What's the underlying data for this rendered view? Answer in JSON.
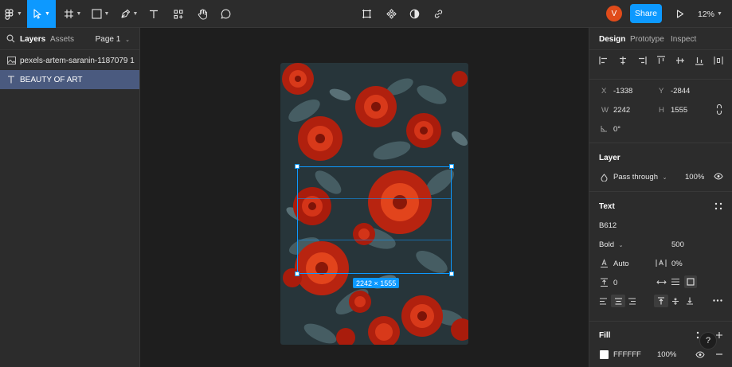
{
  "toolbar": {
    "tools": [
      "main-menu",
      "move",
      "frame",
      "shape",
      "pen",
      "text",
      "resources",
      "hand",
      "comment"
    ],
    "avatar_initial": "V",
    "share_label": "Share",
    "zoom_label": "12%"
  },
  "left_panel": {
    "tabs": [
      "Layers",
      "Assets"
    ],
    "page_label": "Page 1",
    "layers": [
      {
        "name": "pexels-artem-saranin-1187079 1",
        "icon": "image-icon"
      },
      {
        "name": "BEAUTY OF ART",
        "icon": "text-icon",
        "selected": true
      }
    ]
  },
  "canvas": {
    "dimension_label": "2242 × 1555"
  },
  "right_panel": {
    "tabs": [
      "Design",
      "Prototype",
      "Inspect"
    ],
    "position": {
      "x_label": "X",
      "x": "-1338",
      "y_label": "Y",
      "y": "-2844"
    },
    "size": {
      "w_label": "W",
      "w": "2242",
      "h_label": "H",
      "h": "1555"
    },
    "rotation": "0°",
    "layer": {
      "title": "Layer",
      "blend": "Pass through",
      "opacity": "100%"
    },
    "text": {
      "title": "Text",
      "font": "B612",
      "weight": "Bold",
      "size": "500",
      "line_height": "Auto",
      "letter_spacing": "0%",
      "paragraph_spacing": "0"
    },
    "fill": {
      "title": "Fill",
      "color": "FFFFFF",
      "opacity": "100%"
    },
    "help": "?"
  },
  "colors": {
    "accent": "#0d99ff",
    "panel": "#2c2c2c",
    "canvas": "#1e1e1e",
    "selected_layer": "#4a5a7f",
    "avatar": "#e04b1a"
  }
}
